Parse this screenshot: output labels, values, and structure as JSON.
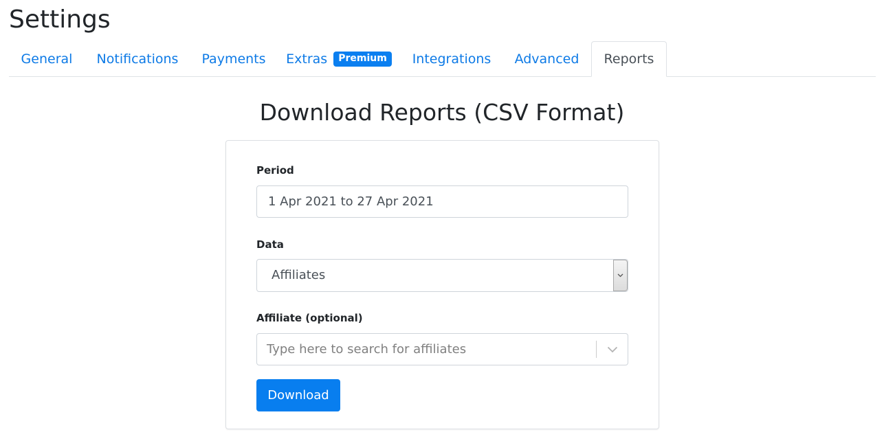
{
  "page": {
    "title": "Settings"
  },
  "tabs": [
    {
      "label": "General",
      "active": false
    },
    {
      "label": "Notifications",
      "active": false
    },
    {
      "label": "Payments",
      "active": false
    },
    {
      "label": "Extras",
      "badge": "Premium",
      "active": false
    },
    {
      "label": "Integrations",
      "active": false
    },
    {
      "label": "Advanced",
      "active": false
    },
    {
      "label": "Reports",
      "active": true
    }
  ],
  "report": {
    "heading": "Download Reports (CSV Format)",
    "period": {
      "label": "Period",
      "value": "1 Apr 2021 to 27 Apr 2021"
    },
    "data": {
      "label": "Data",
      "selected": "Affiliates"
    },
    "affiliate": {
      "label": "Affiliate (optional)",
      "placeholder": "Type here to search for affiliates"
    },
    "download_label": "Download"
  },
  "icons": {
    "select_arrow": "chevron-down-icon",
    "search_dropdown": "chevron-down-icon"
  },
  "colors": {
    "link": "#0d7ae6",
    "primary": "#087eef",
    "badge": "#0b7ff0",
    "border": "#dee2e6"
  }
}
